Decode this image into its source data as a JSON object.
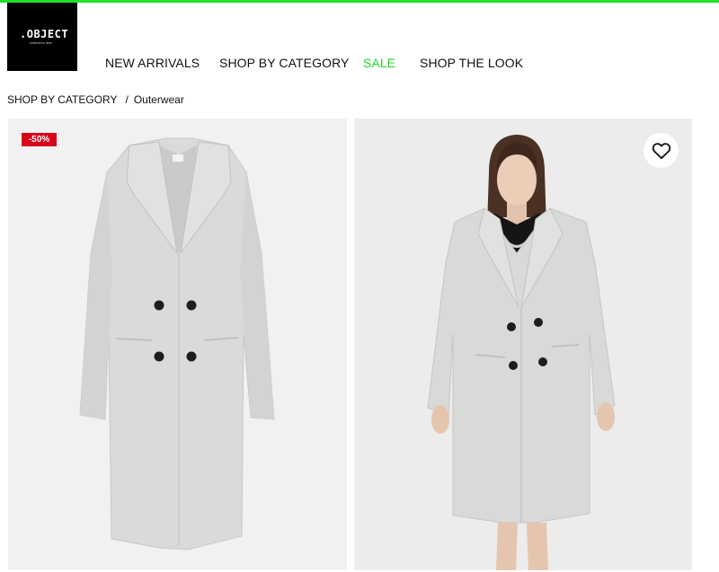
{
  "brand": {
    "name": ".OBJECT",
    "tagline": "collectors item"
  },
  "nav": {
    "items": [
      "NEW ARRIVALS",
      "SHOP BY CATEGORY",
      "SALE",
      "SHOP THE LOOK"
    ]
  },
  "breadcrumb": {
    "parent": "SHOP BY CATEGORY",
    "separator": "/",
    "current": "Outerwear"
  },
  "product": {
    "discount_badge": "-50%"
  },
  "icons": {
    "wishlist": "heart-icon"
  },
  "colors": {
    "accent_green": "#22d42a",
    "badge_red": "#d9001b",
    "coat": "#d8dad8"
  }
}
